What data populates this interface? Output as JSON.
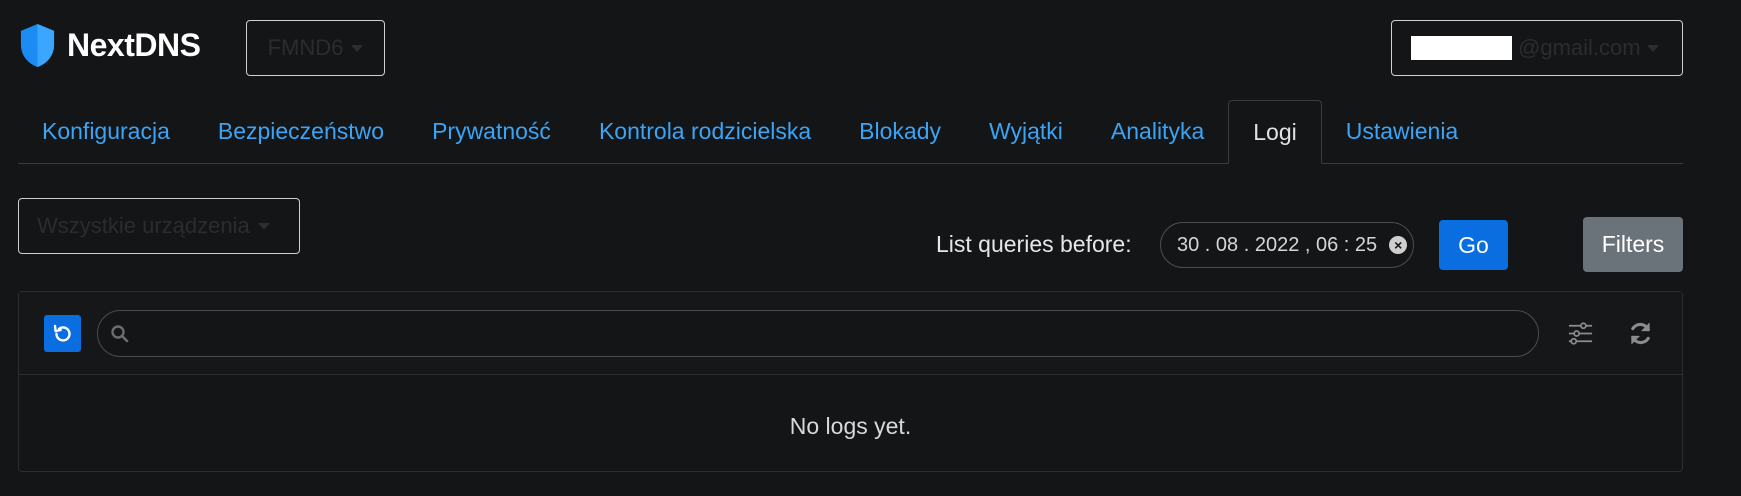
{
  "header": {
    "brand": "NextDNS",
    "config_id": "FMND6",
    "account_suffix": "@gmail.com"
  },
  "tabs": [
    {
      "label": "Konfiguracja",
      "active": false
    },
    {
      "label": "Bezpieczeństwo",
      "active": false
    },
    {
      "label": "Prywatność",
      "active": false
    },
    {
      "label": "Kontrola rodzicielska",
      "active": false
    },
    {
      "label": "Blokady",
      "active": false
    },
    {
      "label": "Wyjątki",
      "active": false
    },
    {
      "label": "Analityka",
      "active": false
    },
    {
      "label": "Logi",
      "active": true
    },
    {
      "label": "Ustawienia",
      "active": false
    }
  ],
  "controls": {
    "device_filter": "Wszystkie urządzenia",
    "list_before_label": "List queries before:",
    "date_value": "30 . 08 . 2022 ,  06 : 25",
    "go_label": "Go",
    "filters_label": "Filters"
  },
  "logs": {
    "search_placeholder": "",
    "empty_message": "No logs yet."
  },
  "colors": {
    "background": "#141517",
    "accent": "#0a6de0",
    "link": "#3ba4f5",
    "filters_button": "#6b737a"
  },
  "icons": {
    "logo": "shield-icon",
    "live": "live-refresh-icon",
    "search": "search-icon",
    "tune": "sliders-icon",
    "refresh": "refresh-icon",
    "clear": "clear-icon",
    "dropdown": "caret-down-icon"
  }
}
